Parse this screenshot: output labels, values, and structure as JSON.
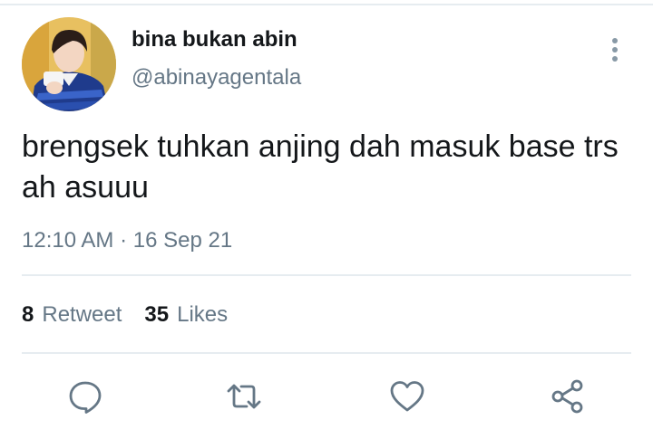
{
  "tweet": {
    "display_name": "bina bukan abin",
    "handle": "@abinayagentala",
    "text": "brengsek tuhkan anjing dah masuk base trs ah asuuu",
    "timestamp": "12:10 AM · 16 Sep 21"
  },
  "stats": {
    "retweets": {
      "count": "8",
      "label": "Retweet"
    },
    "likes": {
      "count": "35",
      "label": "Likes"
    }
  },
  "actions": [
    {
      "icon": "reply-icon"
    },
    {
      "icon": "retweet-icon"
    },
    {
      "icon": "like-icon"
    },
    {
      "icon": "share-icon"
    }
  ],
  "colors": {
    "text": "#14171a",
    "secondary": "#657786",
    "icon": "#657786",
    "divider": "#e6ecf0"
  }
}
